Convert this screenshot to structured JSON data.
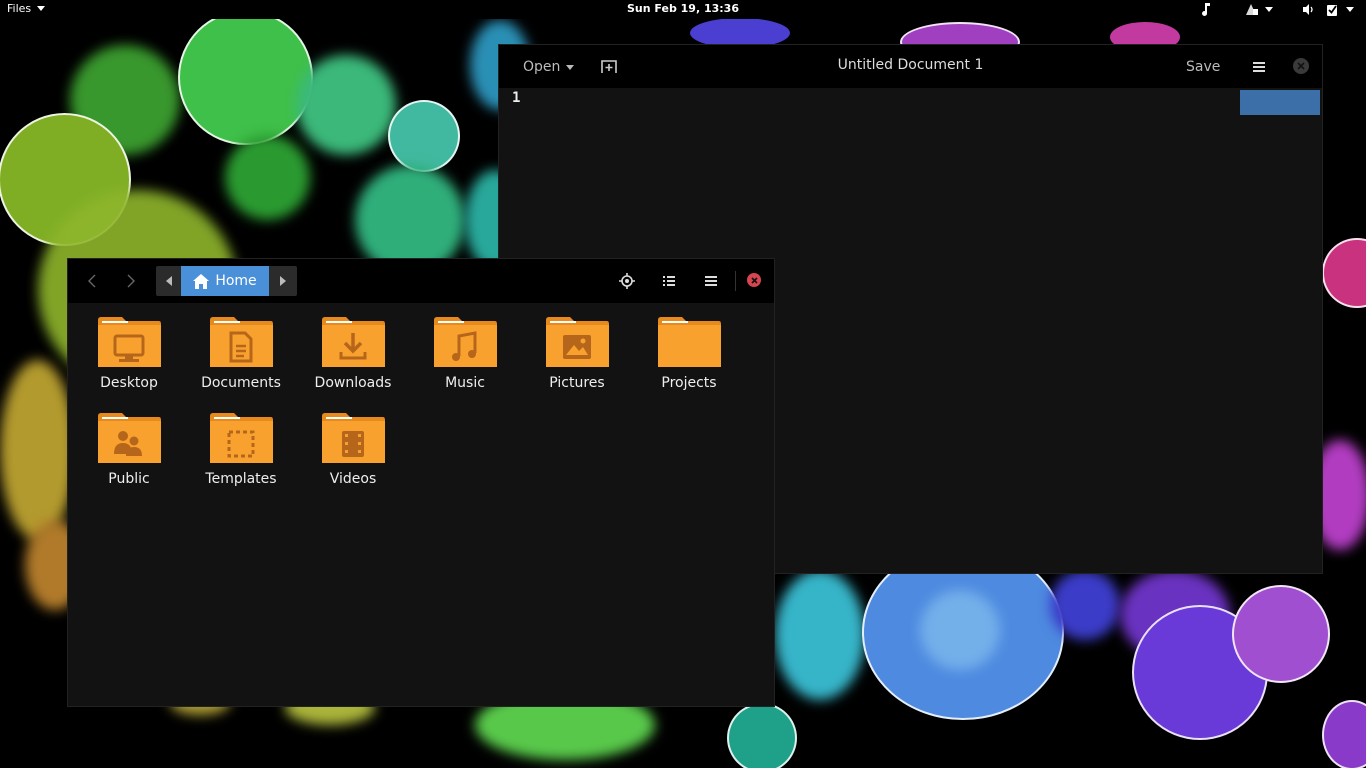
{
  "topbar": {
    "app_menu": "Files",
    "clock": "Sun Feb 19, 13:36",
    "icons": [
      "music-note-icon",
      "network-icon",
      "volume-icon",
      "checkbox-icon"
    ]
  },
  "gedit": {
    "open_label": "Open",
    "title": "Untitled Document 1",
    "save_label": "Save",
    "line_number": "1",
    "accent": "#3c6ea8"
  },
  "files": {
    "path_home": "Home",
    "accent": "#4a90d9",
    "folders": [
      {
        "label": "Desktop",
        "icon": "desktop-icon"
      },
      {
        "label": "Documents",
        "icon": "document-icon"
      },
      {
        "label": "Downloads",
        "icon": "download-icon"
      },
      {
        "label": "Music",
        "icon": "music-icon"
      },
      {
        "label": "Pictures",
        "icon": "picture-icon"
      },
      {
        "label": "Projects",
        "icon": "folder-icon"
      },
      {
        "label": "Public",
        "icon": "people-icon"
      },
      {
        "label": "Templates",
        "icon": "template-icon"
      },
      {
        "label": "Videos",
        "icon": "video-icon"
      }
    ],
    "folder_color": "#f9a12e"
  }
}
